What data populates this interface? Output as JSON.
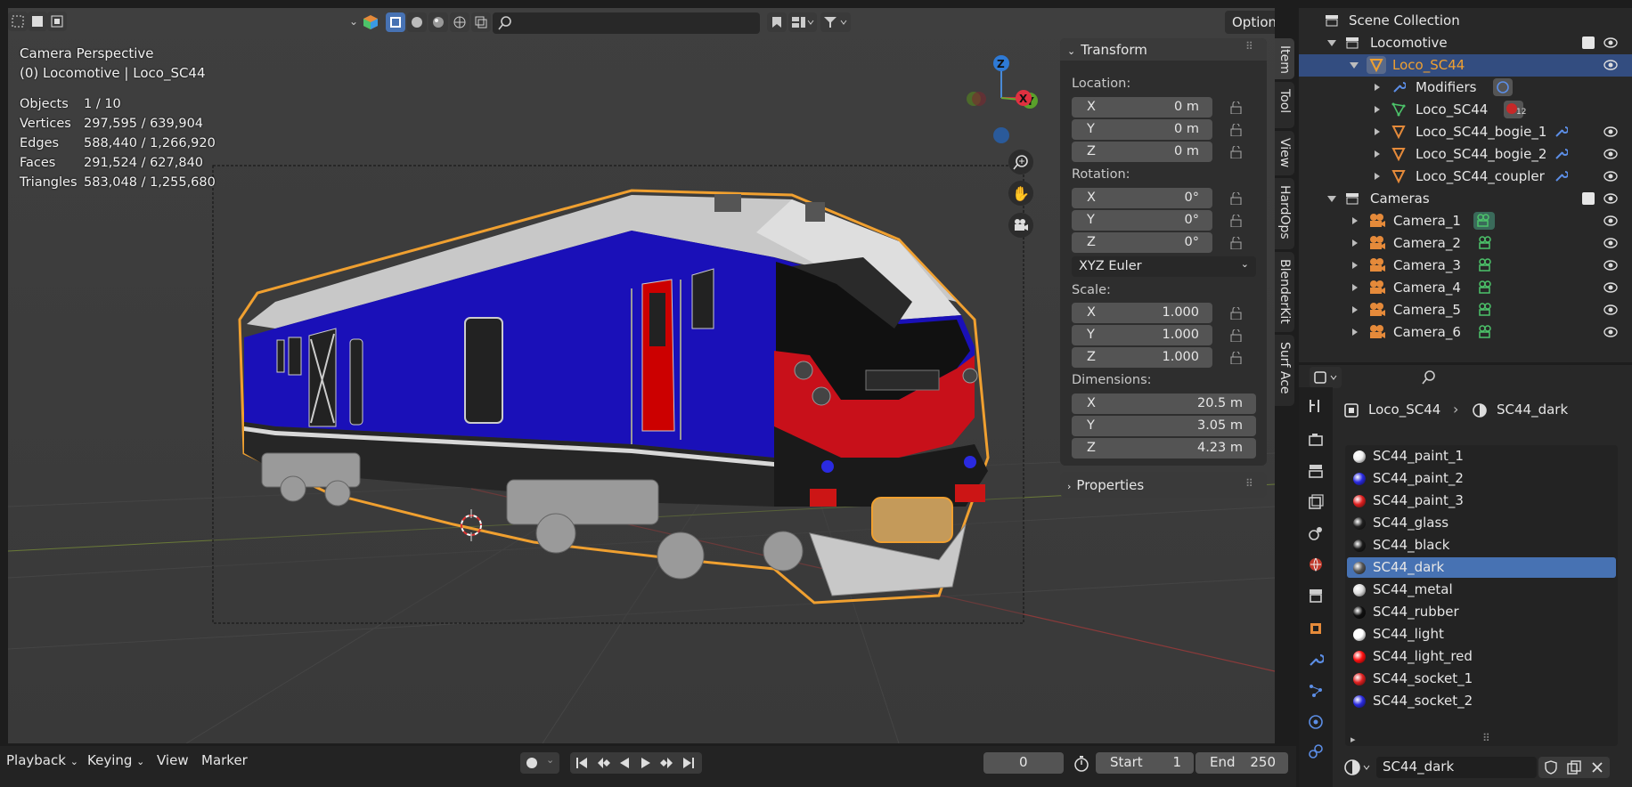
{
  "viewport": {
    "view_name": "Camera Perspective",
    "active_object": "(0) Locomotive | Loco_SC44",
    "stats": [
      {
        "label": "Objects",
        "value": "1 / 10"
      },
      {
        "label": "Vertices",
        "value": "297,595 / 639,904"
      },
      {
        "label": "Edges",
        "value": "588,440 / 1,266,920"
      },
      {
        "label": "Faces",
        "value": "291,524 / 627,840"
      },
      {
        "label": "Triangles",
        "value": "583,048 / 1,255,680"
      }
    ],
    "options_label": "Options",
    "gizmo": {
      "z": "Z",
      "x": "X",
      "y": "Y"
    },
    "colors": {
      "body_blue": "#1a10b8",
      "nose_red": "#c8101a",
      "selection": "#f0a030",
      "background": "#3d3d3d"
    }
  },
  "npanel": {
    "transform_title": "Transform",
    "location_label": "Location:",
    "location": [
      {
        "axis": "X",
        "value": "0 m"
      },
      {
        "axis": "Y",
        "value": "0 m"
      },
      {
        "axis": "Z",
        "value": "0 m"
      }
    ],
    "rotation_label": "Rotation:",
    "rotation": [
      {
        "axis": "X",
        "value": "0°"
      },
      {
        "axis": "Y",
        "value": "0°"
      },
      {
        "axis": "Z",
        "value": "0°"
      }
    ],
    "rotation_mode": "XYZ Euler",
    "scale_label": "Scale:",
    "scale": [
      {
        "axis": "X",
        "value": "1.000"
      },
      {
        "axis": "Y",
        "value": "1.000"
      },
      {
        "axis": "Z",
        "value": "1.000"
      }
    ],
    "dimensions_label": "Dimensions:",
    "dimensions": [
      {
        "axis": "X",
        "value": "20.5 m"
      },
      {
        "axis": "Y",
        "value": "3.05 m"
      },
      {
        "axis": "Z",
        "value": "4.23 m"
      }
    ],
    "properties_title": "Properties",
    "tabs": [
      "Item",
      "Tool",
      "View",
      "HardOps",
      "BlenderKit",
      "Surf Ace"
    ]
  },
  "timeline": {
    "playback": "Playback",
    "keying": "Keying",
    "view": "View",
    "marker": "Marker",
    "current_frame": "0",
    "start_label": "Start",
    "start_value": "1",
    "end_label": "End",
    "end_value": "250"
  },
  "outliner": {
    "rows": [
      {
        "label": "Scene Collection"
      },
      {
        "label": "Locomotive"
      },
      {
        "label": "Loco_SC44"
      },
      {
        "label": "Modifiers"
      },
      {
        "label": "Loco_SC44"
      },
      {
        "label": "Loco_SC44_bogie_1"
      },
      {
        "label": "Loco_SC44_bogie_2"
      },
      {
        "label": "Loco_SC44_coupler"
      },
      {
        "label": "Cameras"
      },
      {
        "label": "Camera_1"
      },
      {
        "label": "Camera_2"
      },
      {
        "label": "Camera_3"
      },
      {
        "label": "Camera_4"
      },
      {
        "label": "Camera_5"
      },
      {
        "label": "Camera_6"
      }
    ],
    "mesh_users": "12"
  },
  "properties": {
    "breadcrumb_object": "Loco_SC44",
    "breadcrumb_material": "SC44_dark",
    "materials": [
      {
        "name": "SC44_paint_1",
        "color": "#f0f0f0"
      },
      {
        "name": "SC44_paint_2",
        "color": "#2a2ae0"
      },
      {
        "name": "SC44_paint_3",
        "color": "#e02020"
      },
      {
        "name": "SC44_glass",
        "color": "#202020"
      },
      {
        "name": "SC44_black",
        "color": "#1a1a1a"
      },
      {
        "name": "SC44_dark",
        "color": "#555555"
      },
      {
        "name": "SC44_metal",
        "color": "#dddddd"
      },
      {
        "name": "SC44_rubber",
        "color": "#101010"
      },
      {
        "name": "SC44_light",
        "color": "#ffffff"
      },
      {
        "name": "SC44_light_red",
        "color": "#ff1010"
      },
      {
        "name": "SC44_socket_1",
        "color": "#e02020"
      },
      {
        "name": "SC44_socket_2",
        "color": "#2a2ae0"
      }
    ],
    "active_material": "SC44_dark"
  }
}
